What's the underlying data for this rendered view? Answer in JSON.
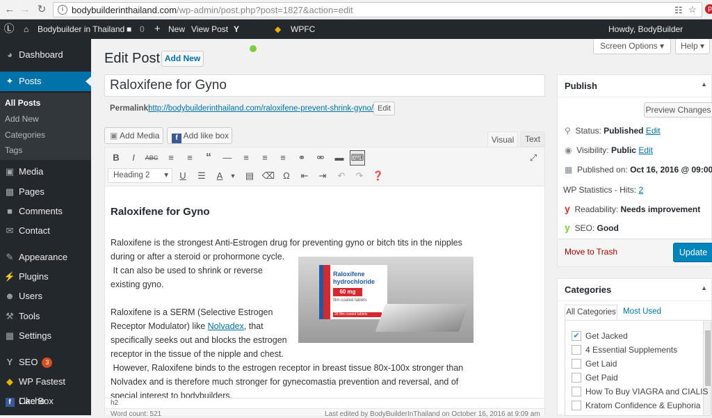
{
  "browser": {
    "url_host": "bodybuilderinthailand.com",
    "url_rest": "/wp-admin/post.php?post=1827&action=edit"
  },
  "adminbar": {
    "site_name": "Bodybuilder in Thailand",
    "comments_count": "0",
    "new_label": "New",
    "view_post": "View Post",
    "wpfc": "WPFC",
    "howdy": "Howdy, BodyBuilder InThailand"
  },
  "sidebar": {
    "items": [
      {
        "label": "Dashboard",
        "icon": "dashboard-icon"
      },
      {
        "label": "Posts",
        "icon": "pin-icon"
      },
      {
        "label": "Media",
        "icon": "media-icon"
      },
      {
        "label": "Pages",
        "icon": "pages-icon"
      },
      {
        "label": "Comments",
        "icon": "comments-icon"
      },
      {
        "label": "Contact",
        "icon": "mail-icon"
      },
      {
        "label": "Appearance",
        "icon": "brush-icon"
      },
      {
        "label": "Plugins",
        "icon": "plug-icon"
      },
      {
        "label": "Users",
        "icon": "user-icon"
      },
      {
        "label": "Tools",
        "icon": "wrench-icon"
      },
      {
        "label": "Settings",
        "icon": "settings-icon"
      },
      {
        "label": "SEO",
        "icon": "yoast-icon",
        "badge": "3"
      },
      {
        "label": "WP Fastest Cache",
        "icon": "cheetah-icon"
      },
      {
        "label": "Like Box",
        "icon": "facebook-icon"
      }
    ],
    "sub": [
      "All Posts",
      "Add New",
      "Categories",
      "Tags"
    ]
  },
  "screen_options": "Screen Options",
  "help": "Help",
  "page": {
    "heading": "Edit Post",
    "add_new": "Add New",
    "title_value": "Raloxifene for Gyno",
    "permalink_label": "Permalink:",
    "permalink_url": "http://bodybuilderinthailand.com/raloxifene-prevent-shrink-gyno/",
    "permalink_edit": "Edit",
    "add_media": "Add Media",
    "add_like_box": "Add like box",
    "tab_visual": "Visual",
    "tab_text": "Text",
    "format_select": "Heading 2",
    "path": "h2",
    "word_count": "Word count: 521",
    "last_edited": "Last edited by BodyBuilderInThailand on October 16, 2016 at 9:09 am"
  },
  "content": {
    "heading": "Raloxifene for Gyno",
    "p1a": "Raloxifene is the strongest Anti-Estrogen drug for preventing gyno or bitch tits in the nipples",
    "p1b": "during or after a steroid or prohormone cycle.",
    "p1c": " It can also be used to shrink or reverse",
    "p1d": "existing gyno.",
    "p2a": "Raloxifene is a SERM (Selective Estrogen",
    "p2b_pre": "Receptor Modulator) like ",
    "p2b_link": "Nolvadex",
    "p2b_post": ", that",
    "p2c": "specifically seeks out and blocks the estrogen",
    "p2d": "receptor in the tissue of the nipple and chest.",
    "p2e": " However, Raloxifene binds to the estrogen receptor in breast tissue 80x-100x stronger than",
    "p2f": "Nolvadex and is therefore much stronger for gynecomastia prevention and reversal, and of",
    "p2g": "special interest to bodybuilders.",
    "image_lines": [
      "Raloxifene",
      "hydrochloride",
      "60 mg",
      "film-coated tablets",
      "28 film-coated tablets"
    ]
  },
  "publish": {
    "title": "Publish",
    "preview": "Preview Changes",
    "status_label": "Status:",
    "status_value": "Published",
    "visibility_label": "Visibility:",
    "visibility_value": "Public",
    "published_label": "Published on:",
    "published_value": "Oct 16, 2016 @ 09:00",
    "edit": "Edit",
    "stats_label": "WP Statistics - Hits:",
    "stats_value": "2",
    "readability_label": "Readability:",
    "readability_value": "Needs improvement",
    "seo_label": "SEO:",
    "seo_value": "Good",
    "trash": "Move to Trash",
    "update": "Update"
  },
  "categories": {
    "title": "Categories",
    "tab_all": "All Categories",
    "tab_used": "Most Used",
    "items": [
      {
        "label": "Get Jacked",
        "checked": true
      },
      {
        "label": "4 Essential Supplements",
        "checked": false
      },
      {
        "label": "Get Laid",
        "checked": false
      },
      {
        "label": "Get Paid",
        "checked": false
      },
      {
        "label": "How To Buy VIAGRA and CIALIS",
        "checked": false
      },
      {
        "label": "Kratom Confidence & Euphoria",
        "checked": false
      }
    ]
  },
  "colors": {
    "accent": "#0073aa",
    "admin_dark": "#23282d",
    "trash": "#a00"
  }
}
